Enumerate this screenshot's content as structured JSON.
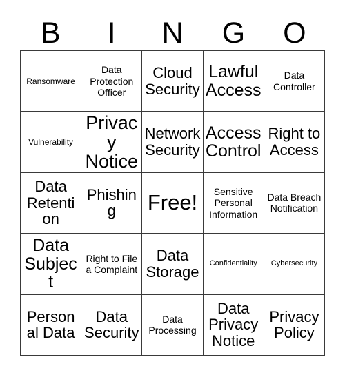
{
  "header": {
    "letters": [
      "B",
      "I",
      "N",
      "G",
      "O"
    ]
  },
  "grid": {
    "rows": 5,
    "columns": 5,
    "border_color": "#3a3a3a",
    "background_color": "#ffffff",
    "text_color": "#000000",
    "cells": [
      [
        {
          "label": "Ransomware",
          "size": "sm"
        },
        {
          "label": "Data Protection Officer",
          "size": "md"
        },
        {
          "label": "Cloud Security",
          "size": "xl"
        },
        {
          "label": "Lawful Access",
          "size": "2xl"
        },
        {
          "label": "Data Controller",
          "size": "md"
        }
      ],
      [
        {
          "label": "Vulnerability",
          "size": "sm"
        },
        {
          "label": "Privacy Notice",
          "size": "3xl"
        },
        {
          "label": "Network Security",
          "size": "xl"
        },
        {
          "label": "Access Control",
          "size": "2xl"
        },
        {
          "label": "Right to Access",
          "size": "xl"
        }
      ],
      [
        {
          "label": "Data Retention",
          "size": "xl"
        },
        {
          "label": "Phishing",
          "size": "xl"
        },
        {
          "label": "Free!",
          "size": "free"
        },
        {
          "label": "Sensitive Personal Information",
          "size": "md"
        },
        {
          "label": "Data Breach Notification",
          "size": "md"
        }
      ],
      [
        {
          "label": "Data Subject",
          "size": "2xl"
        },
        {
          "label": "Right to File a Complaint",
          "size": "md"
        },
        {
          "label": "Data Storage",
          "size": "xl"
        },
        {
          "label": "Confidentiality",
          "size": "xs"
        },
        {
          "label": "Cybersecurity",
          "size": "xs"
        }
      ],
      [
        {
          "label": "Personal Data",
          "size": "xl"
        },
        {
          "label": "Data Security",
          "size": "xl"
        },
        {
          "label": "Data Processing",
          "size": "md"
        },
        {
          "label": "Data Privacy Notice",
          "size": "xl"
        },
        {
          "label": "Privacy Policy",
          "size": "xl"
        }
      ]
    ]
  }
}
